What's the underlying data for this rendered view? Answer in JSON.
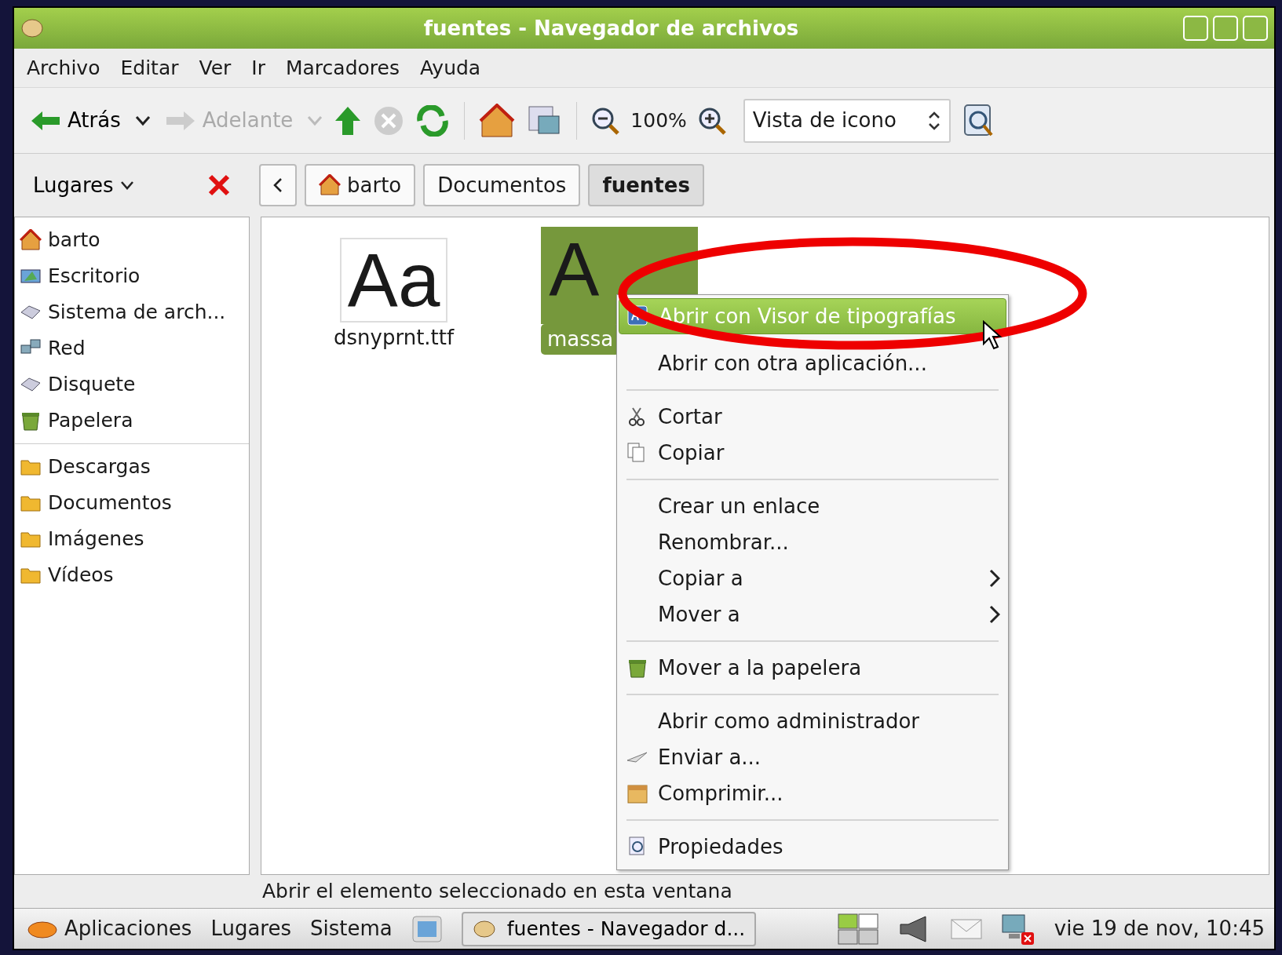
{
  "window": {
    "title": "fuentes - Navegador de archivos"
  },
  "menu_bar": [
    "Archivo",
    "Editar",
    "Ver",
    "Ir",
    "Marcadores",
    "Ayuda"
  ],
  "toolbar": {
    "back": {
      "label": "Atrás",
      "disabled": false
    },
    "forward": {
      "label": "Adelante",
      "disabled": true
    },
    "zoom": "100%",
    "view_mode": "Vista de icono"
  },
  "sidebar": {
    "title": "Lugares",
    "groups": [
      [
        {
          "label": "barto"
        },
        {
          "label": "Escritorio"
        },
        {
          "label": "Sistema de arch..."
        },
        {
          "label": "Red"
        },
        {
          "label": "Disquete"
        },
        {
          "label": "Papelera"
        }
      ],
      [
        {
          "label": "Descargas"
        },
        {
          "label": "Documentos"
        },
        {
          "label": "Imágenes"
        },
        {
          "label": "Vídeos"
        }
      ]
    ]
  },
  "path_bar": [
    {
      "label": "barto",
      "selected": false
    },
    {
      "label": "Documentos",
      "selected": false
    },
    {
      "label": "fuentes",
      "selected": true
    }
  ],
  "files": [
    {
      "name": "dsnyprnt.ttf",
      "preview": "Aa",
      "selected": false
    },
    {
      "name": "massa",
      "preview": "A",
      "selected": true
    }
  ],
  "context_menu": {
    "sections": [
      [
        {
          "label": "Abrir con Visor de tipografías",
          "highlighted": true
        },
        {
          "label": "Abrir con otra aplicación...",
          "highlighted": false
        }
      ],
      [
        {
          "label": "Cortar",
          "highlighted": false
        },
        {
          "label": "Copiar",
          "highlighted": false
        }
      ],
      [
        {
          "label": "Crear un enlace",
          "highlighted": false
        },
        {
          "label": "Renombrar...",
          "highlighted": false
        },
        {
          "label": "Copiar a",
          "submenu": true,
          "highlighted": false
        },
        {
          "label": "Mover a",
          "submenu": true,
          "highlighted": false
        }
      ],
      [
        {
          "label": "Mover a la papelera",
          "highlighted": false
        }
      ],
      [
        {
          "label": "Abrir como administrador",
          "highlighted": false
        },
        {
          "label": "Enviar a...",
          "highlighted": false
        },
        {
          "label": "Comprimir...",
          "highlighted": false
        }
      ],
      [
        {
          "label": "Propiedades",
          "highlighted": false
        }
      ]
    ]
  },
  "status_bar": "Abrir el elemento seleccionado en esta ventana",
  "taskbar": {
    "menus": [
      "Aplicaciones",
      "Lugares",
      "Sistema"
    ],
    "window_button": "fuentes - Navegador d...",
    "clock": "vie 19 de nov, 10:45"
  }
}
